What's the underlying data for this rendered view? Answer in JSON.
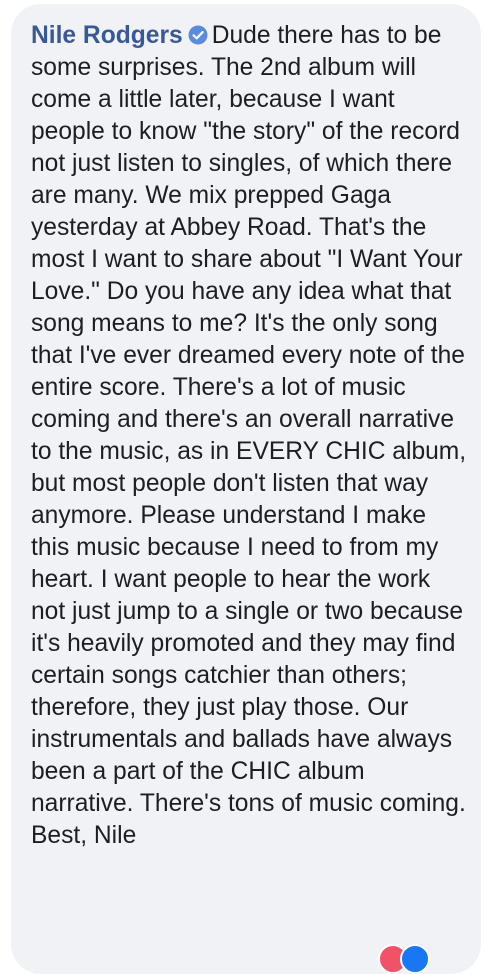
{
  "comment": {
    "author": "Nile Rodgers",
    "verified_icon": "verified-badge-icon",
    "text": "Dude there has to be some surprises. The 2nd album will come a little later, because I want people to know \"the story\" of the record not just listen to singles, of which there are many. We mix prepped Gaga yesterday at Abbey Road. That's the most I want to share about \"I Want Your Love.\" Do you have any idea what that song means to me? It's the only song that I've ever dreamed every note of the entire score. There's a lot of music coming and there's an overall narrative to the music, as in EVERY CHIC album, but most people don't listen that way anymore. Please understand I make this music because I need to from my heart. I want people to hear the work not just jump to a single or two because it's heavily promoted and they may find certain songs catchier than others; therefore, they just play those. Our instrumentals and ballads have always been a part of the CHIC album narrative. There's tons of music coming. Best, Nile"
  },
  "reactions": {
    "icons": [
      "love-reaction-icon",
      "like-reaction-icon"
    ],
    "colors": {
      "love": "#f25268",
      "like": "#1877f2"
    }
  },
  "colors": {
    "bubble_background": "#f0f2f5",
    "author_link": "#385898",
    "text": "#1c1e21",
    "verified_badge": "#5b8be0"
  }
}
